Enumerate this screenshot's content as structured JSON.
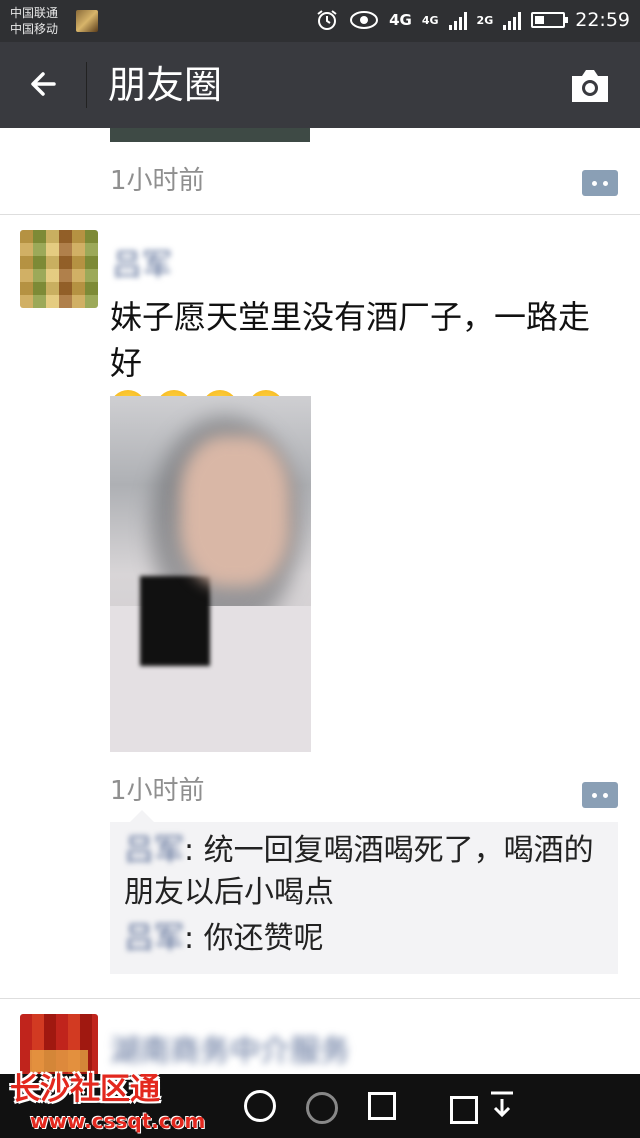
{
  "status_bar": {
    "carrier_1": "中国联通",
    "carrier_2": "中国移动",
    "network_1": "4G",
    "network_2": "4G",
    "network_3": "2G",
    "time": "22:59",
    "battery_level": 0.35,
    "icons": [
      "alarm-icon",
      "eye-icon",
      "signal-icon",
      "battery-icon"
    ]
  },
  "header": {
    "title": "朋友圈",
    "back_icon": "arrow-left-icon",
    "camera_icon": "camera-icon",
    "background": "#393a3f"
  },
  "posts": [
    {
      "time": "1小时前"
    },
    {
      "nickname": "吕军",
      "text": "妹子愿天堂里没有酒厂子，一路走好",
      "emoji_count": 4,
      "emoji": "crying-face-icon",
      "time": "1小时前",
      "comments": [
        {
          "name": "吕军",
          "sep": ": ",
          "text": "统一回复喝酒喝死了，喝酒的朋友以后小喝点"
        },
        {
          "name": "吕军",
          "sep": ": ",
          "text": "你还赞呢"
        }
      ]
    },
    {
      "nickname": "湖南商务中介服务"
    }
  ],
  "watermark": {
    "title": "长沙社区通",
    "url": "www.cssqt.com"
  },
  "colors": {
    "link_blue": "#576b95",
    "comment_button": "#8a9fb5",
    "watermark_red": "#e3281e"
  }
}
